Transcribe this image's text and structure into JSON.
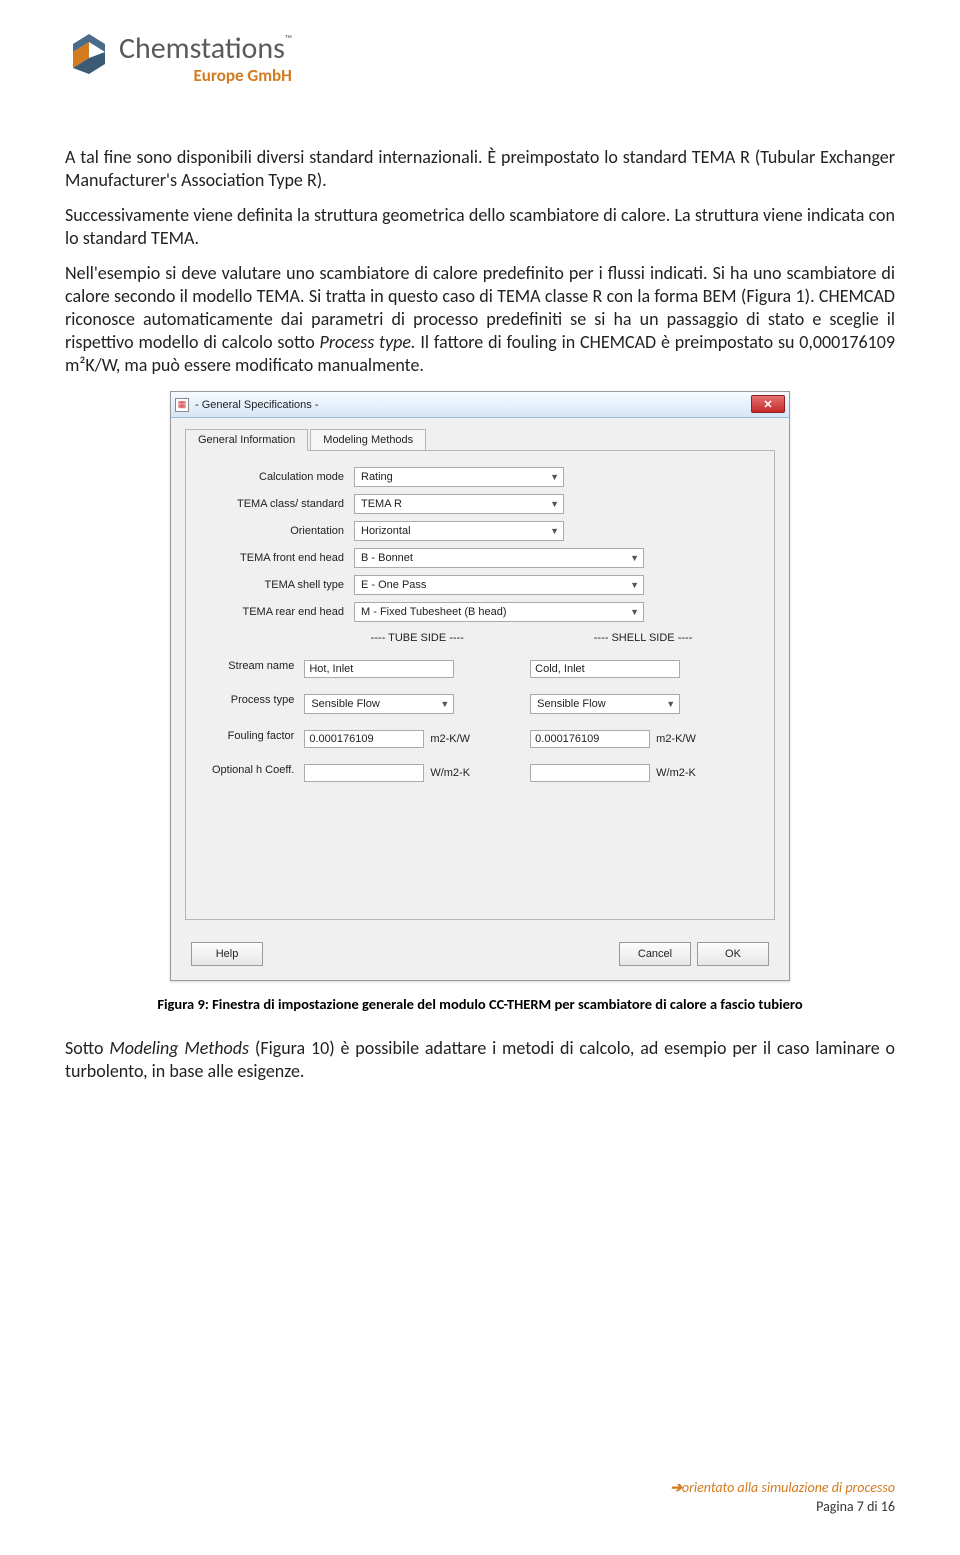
{
  "header": {
    "company": "Chemstations",
    "tm": "™",
    "sub": "Europe GmbH"
  },
  "para1": "A tal fine sono disponibili diversi standard internazionali. È preimpostato lo standard TEMA R (Tubular Exchanger Manufacturer's Association Type R).",
  "para2": "Successivamente viene definita la struttura geometrica dello scambiatore di calore. La struttura viene indicata con lo standard TEMA.",
  "para3a": "Nell'esempio si deve valutare uno scambiatore di calore predefinito per i flussi indicati. Si ha uno scambiatore di calore secondo il modello TEMA. Si tratta in questo caso di TEMA classe R con la forma BEM (Figura 1). CHEMCAD riconosce automaticamente dai parametri di processo predefiniti se si ha un passaggio di stato e sceglie il rispettivo modello di calcolo sotto ",
  "para3i": "Process type.",
  "para3b": " Il fattore di fouling in CHEMCAD è preimpostato su 0,000176109 m²K/W, ma può essere modificato manualmente.",
  "dialog": {
    "title": " - General Specifications - ",
    "tabs": {
      "t1": "General Information",
      "t2": "Modeling Methods"
    },
    "labels": {
      "calc": "Calculation mode",
      "tema_class": "TEMA class/ standard",
      "orient": "Orientation",
      "front": "TEMA front end head",
      "shell": "TEMA shell type",
      "rear": "TEMA rear end head",
      "tube_hdr": "---- TUBE SIDE ----",
      "shell_hdr": "---- SHELL SIDE ----",
      "stream": "Stream name",
      "ptype": "Process type",
      "foul": "Fouling factor",
      "hcoef": "Optional h Coeff."
    },
    "values": {
      "calc": "Rating",
      "tema_class": "TEMA R",
      "orient": "Horizontal",
      "front": "B - Bonnet",
      "shell": "E - One Pass",
      "rear": "M - Fixed Tubesheet (B head)",
      "tube_stream": "Hot, Inlet",
      "shell_stream": "Cold, Inlet",
      "tube_ptype": "Sensible Flow",
      "shell_ptype": "Sensible Flow",
      "tube_foul": "0.000176109",
      "shell_foul": "0.000176109",
      "tube_h": "",
      "shell_h": ""
    },
    "units": {
      "foul": "m2-K/W",
      "h": "W/m2-K"
    },
    "buttons": {
      "help": "Help",
      "cancel": "Cancel",
      "ok": "OK"
    }
  },
  "caption": "Figura 9: Finestra di impostazione generale del modulo CC-THERM per scambiatore di calore a fascio tubiero",
  "para4a": "Sotto ",
  "para4i": "Modeling Methods",
  "para4b": " (Figura 10) è possibile adattare i metodi di calcolo, ad esempio per il caso laminare o turbolento, in base alle esigenze.",
  "footer": {
    "slogan": "orientato alla simulazione  di processo",
    "page": "Pagina 7 di 16"
  }
}
